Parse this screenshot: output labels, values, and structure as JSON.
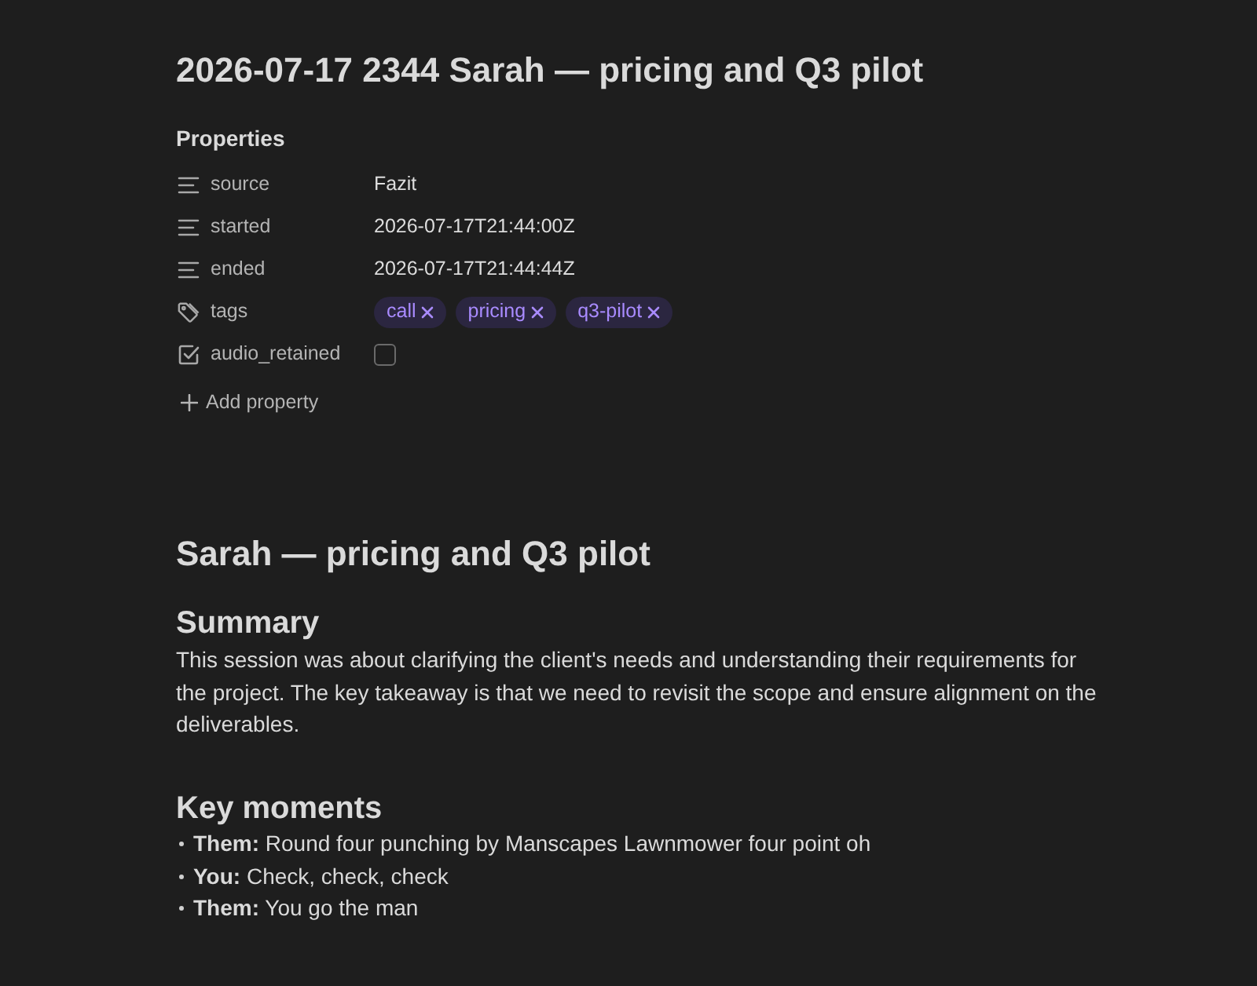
{
  "title": "2026-07-17 2344 Sarah — pricing and Q3 pilot",
  "properties": {
    "heading": "Properties",
    "items": [
      {
        "kind": "text",
        "key": "source",
        "value": "Fazit"
      },
      {
        "kind": "text",
        "key": "started",
        "value": "2026-07-17T21:44:00Z"
      },
      {
        "kind": "text",
        "key": "ended",
        "value": "2026-07-17T21:44:44Z"
      },
      {
        "kind": "tags",
        "key": "tags",
        "tags": [
          "call",
          "pricing",
          "q3-pilot"
        ]
      },
      {
        "kind": "checkbox",
        "key": "audio_retained",
        "checked": false
      }
    ],
    "add_label": "Add property"
  },
  "heading": "Sarah — pricing and Q3 pilot",
  "sections": [
    {
      "kind": "paragraph",
      "heading": "Summary",
      "text": "This session was about clarifying the client's needs and understanding their requirements for the project. The key takeaway is that we need to revisit the scope and ensure alignment on the deliverables."
    },
    {
      "kind": "bullets",
      "heading": "Key moments",
      "items": [
        "**Them:** Round four punching by Manscapes Lawnmower four point oh",
        "**You:** Check, check, check",
        "**Them:** You go the man"
      ]
    }
  ]
}
